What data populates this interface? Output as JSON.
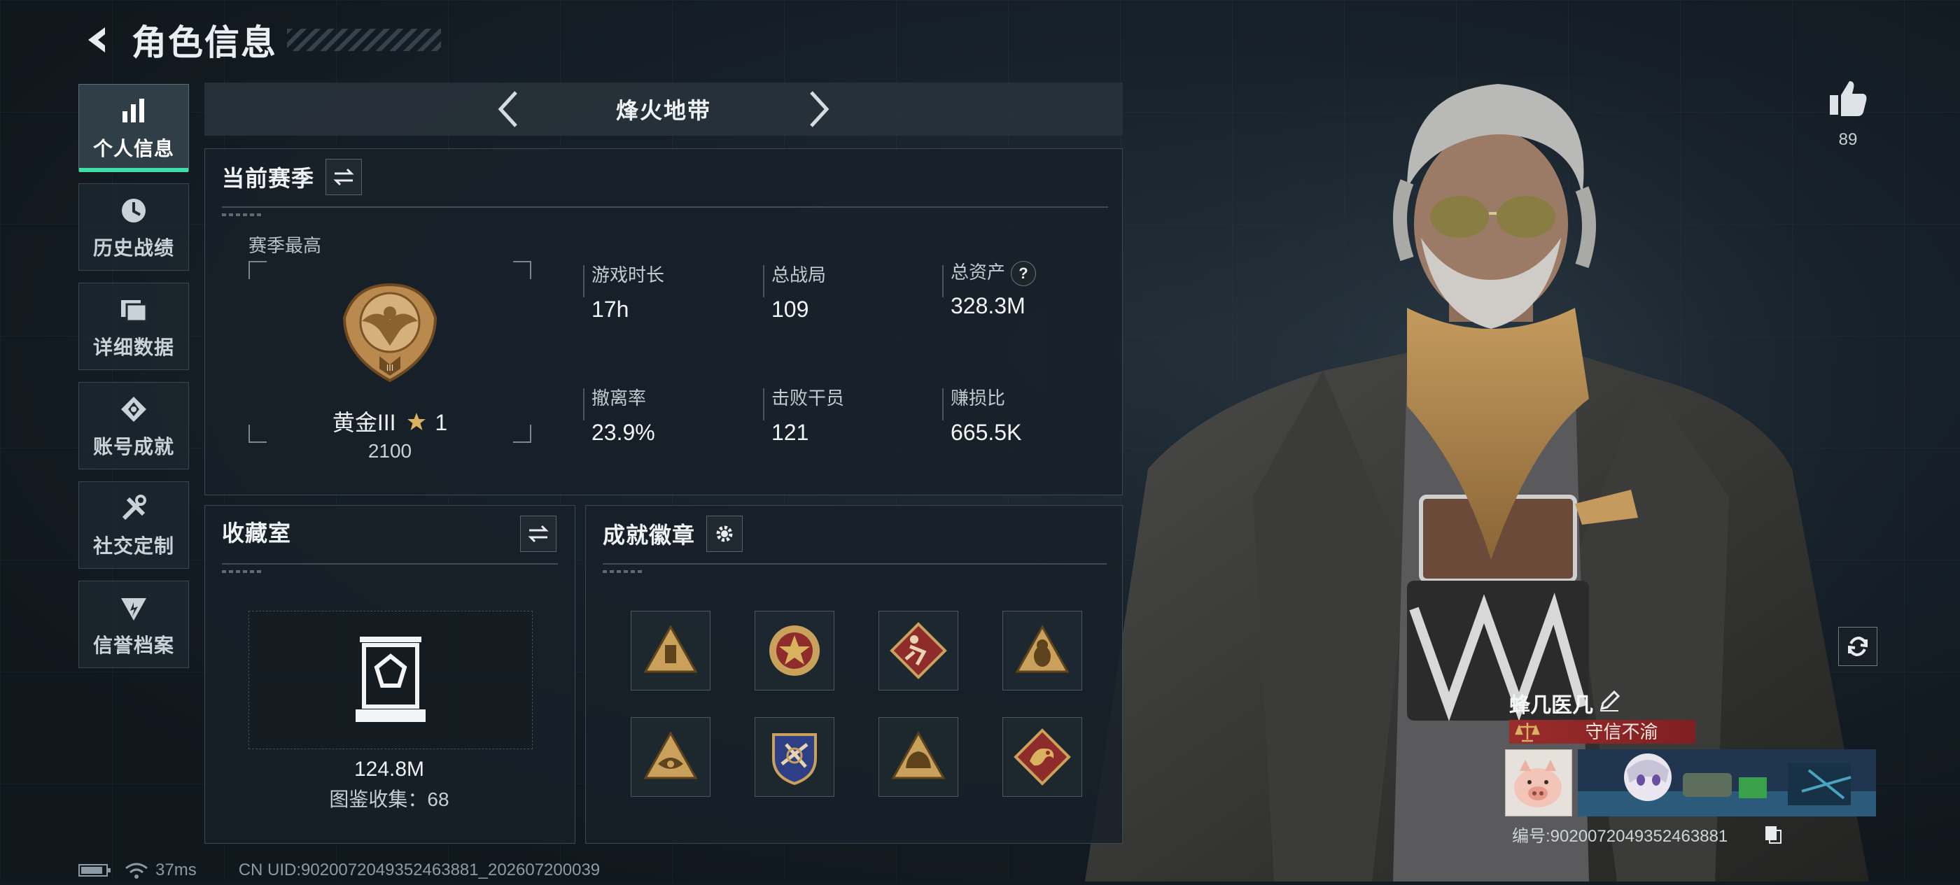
{
  "header": {
    "title": "角色信息"
  },
  "sidebar": {
    "items": [
      {
        "label": "个人信息",
        "icon": "bar-chart-icon",
        "active": true
      },
      {
        "label": "历史战绩",
        "icon": "clock-icon"
      },
      {
        "label": "详细数据",
        "icon": "folder-icon"
      },
      {
        "label": "账号成就",
        "icon": "achievement-icon"
      },
      {
        "label": "社交定制",
        "icon": "tools-icon"
      },
      {
        "label": "信誉档案",
        "icon": "shield-icon"
      }
    ]
  },
  "mode": {
    "title": "烽火地带"
  },
  "season": {
    "title": "当前赛季",
    "sub_label": "赛季最高",
    "rank_name": "黄金III",
    "rank_stars": "1",
    "rank_score": "2100",
    "stats": [
      {
        "label": "游戏时长",
        "value": "17h"
      },
      {
        "label": "总战局",
        "value": "109"
      },
      {
        "label": "总资产",
        "value": "328.3M",
        "help": "?"
      },
      {
        "label": "撤离率",
        "value": "23.9%"
      },
      {
        "label": "击败干员",
        "value": "121"
      },
      {
        "label": "赚损比",
        "value": "665.5K"
      }
    ]
  },
  "collection": {
    "title": "收藏室",
    "value": "124.8M",
    "count_text": "图鉴收集：68"
  },
  "badges": {
    "title": "成就徽章",
    "items": [
      "triangle-badge-icon",
      "star-shield-badge-icon",
      "runner-badge-icon",
      "hazmat-badge-icon",
      "eye-triangle-badge-icon",
      "shield-plane-badge-icon",
      "helmet-badge-icon",
      "dragon-badge-icon"
    ]
  },
  "likes": {
    "count": "89"
  },
  "player": {
    "name": "蜂几医几",
    "title": "守信不渝",
    "id_text": "编号:9020072049352463881"
  },
  "footer": {
    "ping": "37ms",
    "uid_text": "CN UID:9020072049352463881_202607200039"
  },
  "colors": {
    "accent": "#3fe0a8",
    "title_red": "#9a2c2c",
    "gold": "#c9a15a"
  }
}
